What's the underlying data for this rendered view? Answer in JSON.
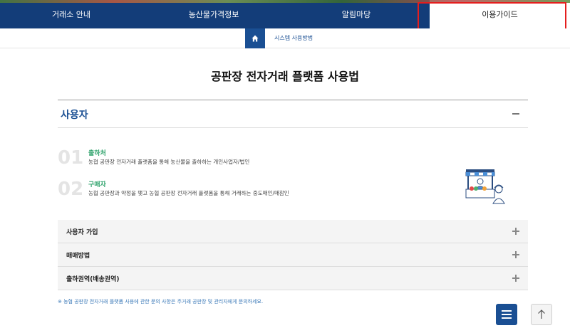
{
  "nav": {
    "items": [
      {
        "label": "거래소 안내"
      },
      {
        "label": "농산물가격정보"
      },
      {
        "label": "알림마당"
      },
      {
        "label": "이용가이드"
      }
    ]
  },
  "breadcrumb": {
    "home_icon": "home-icon",
    "current": "시스템 사용방법"
  },
  "page": {
    "title": "공판장 전자거래 플랫폼 사용법"
  },
  "section": {
    "title": "사용자",
    "collapse_icon": "minus-icon"
  },
  "roles": [
    {
      "num": "01",
      "name": "출하처",
      "desc": "농협 공판장 전자거래 플랫폼을 통해 농산물을 출하하는 개인사업자/법인"
    },
    {
      "num": "02",
      "name": "구매자",
      "desc": "농협 공판장과 약정을 맺고 농협 공판장 전자거래 플랫폼을 통해 거래하는 중도매인/매참인"
    }
  ],
  "accordion": [
    {
      "label": "사용자 가입"
    },
    {
      "label": "매매방법"
    },
    {
      "label": "출하권역(배송권역)"
    }
  ],
  "notice": "※ 농협 공판장 전자거래 플랫폼 사용에 관한 문의 사항은 주거래 공판장 및 관리자에게 문의하세요.",
  "colors": {
    "nav_bg": "#133d79",
    "accent_blue": "#1a4f93",
    "accent_green": "#2ea26b",
    "highlight_red": "#e41e1e"
  }
}
